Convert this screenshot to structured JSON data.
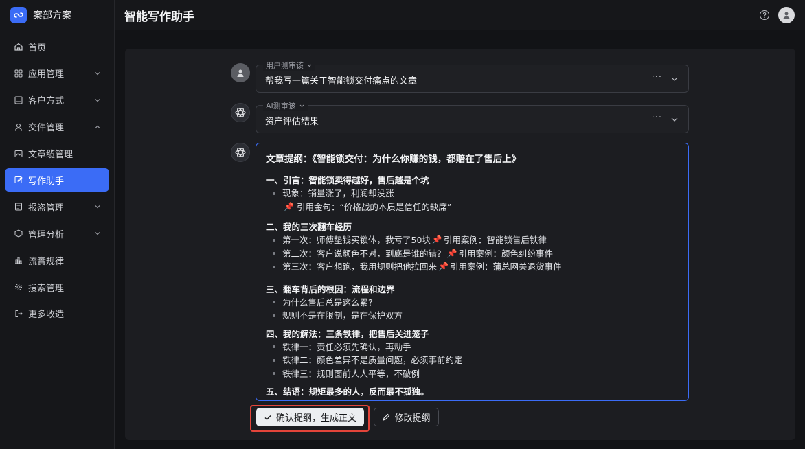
{
  "brand": {
    "name": "案部方案"
  },
  "sidebar": {
    "items": [
      {
        "label": "首页",
        "icon": "home-icon",
        "caret": ""
      },
      {
        "label": "应用管理",
        "icon": "apps-icon",
        "caret": "down"
      },
      {
        "label": "客户方式",
        "icon": "contact-icon",
        "caret": "down"
      },
      {
        "label": "交件管理",
        "icon": "users-icon",
        "caret": "up"
      },
      {
        "label": "文章缆管理",
        "icon": "image-icon",
        "caret": ""
      },
      {
        "label": "写作助手",
        "icon": "edit-icon",
        "caret": "",
        "active": true
      },
      {
        "label": "报盗管理",
        "icon": "report-icon",
        "caret": "down"
      },
      {
        "label": "管理分析",
        "icon": "box-icon",
        "caret": "down"
      },
      {
        "label": "流實规律",
        "icon": "flow-icon",
        "caret": ""
      },
      {
        "label": "搜索管理",
        "icon": "gear-icon",
        "caret": ""
      },
      {
        "label": "更多收造",
        "icon": "logout-icon",
        "caret": ""
      }
    ]
  },
  "header": {
    "title": "智能写作助手"
  },
  "selects": {
    "user": {
      "legend": "用户测审该",
      "value": "帮我写一篇关于智能锁交付痛点的文章",
      "more": "···"
    },
    "ai": {
      "legend": "AI测审该",
      "value": "资产评估结果",
      "more": "···"
    }
  },
  "outline": {
    "title": "文章提纲：《智能锁交付：为什么你赚的钱，都赔在了售后上》",
    "s1": {
      "heading": "一、引言：智能锁卖得越好，售后越是个坑",
      "b1": "现象：销量涨了，利润却没涨",
      "quote": "引用金句：“价格战的本质是信任的缺席”"
    },
    "s2": {
      "heading": "二、我的三次翻车经历",
      "b1a": "第一次：师傅垫钱买锁体，我亏了50块",
      "b1b": "引用案例：智能锁售后铁律",
      "b2a": "第二次：客户说颜色不对，到底是谁的错？",
      "b2b": "引用案例：颜色纠纷事件",
      "b3a": "第三次：客户想跑，我用规则把他拉回来",
      "b3b": "引用案例：蒲总网关退货事件"
    },
    "s3": {
      "heading": "三、翻车背后的根因：流程和边界",
      "b1": "为什么售后总是这么累?",
      "b2": "规则不是在限制，是在保护双方"
    },
    "s4": {
      "heading": "四、我的解法：三条铁律，把售后关进笼子",
      "b1": "铁律一：责任必须先确认，再动手",
      "b2": "铁律二：颜色差异不是质量问题，必须事前约定",
      "b3": "铁律三：规则面前人人平等，不破例"
    },
    "s5": {
      "heading": "五、结语：规矩最多的人，反而最不孤独。"
    },
    "pin_icon": "📌"
  },
  "actions": {
    "confirm": "确认提纲，生成正文",
    "edit": "修改提纲"
  },
  "colors": {
    "accent": "#3b6cf6",
    "highlight": "#e3443a",
    "background": "#121316"
  }
}
